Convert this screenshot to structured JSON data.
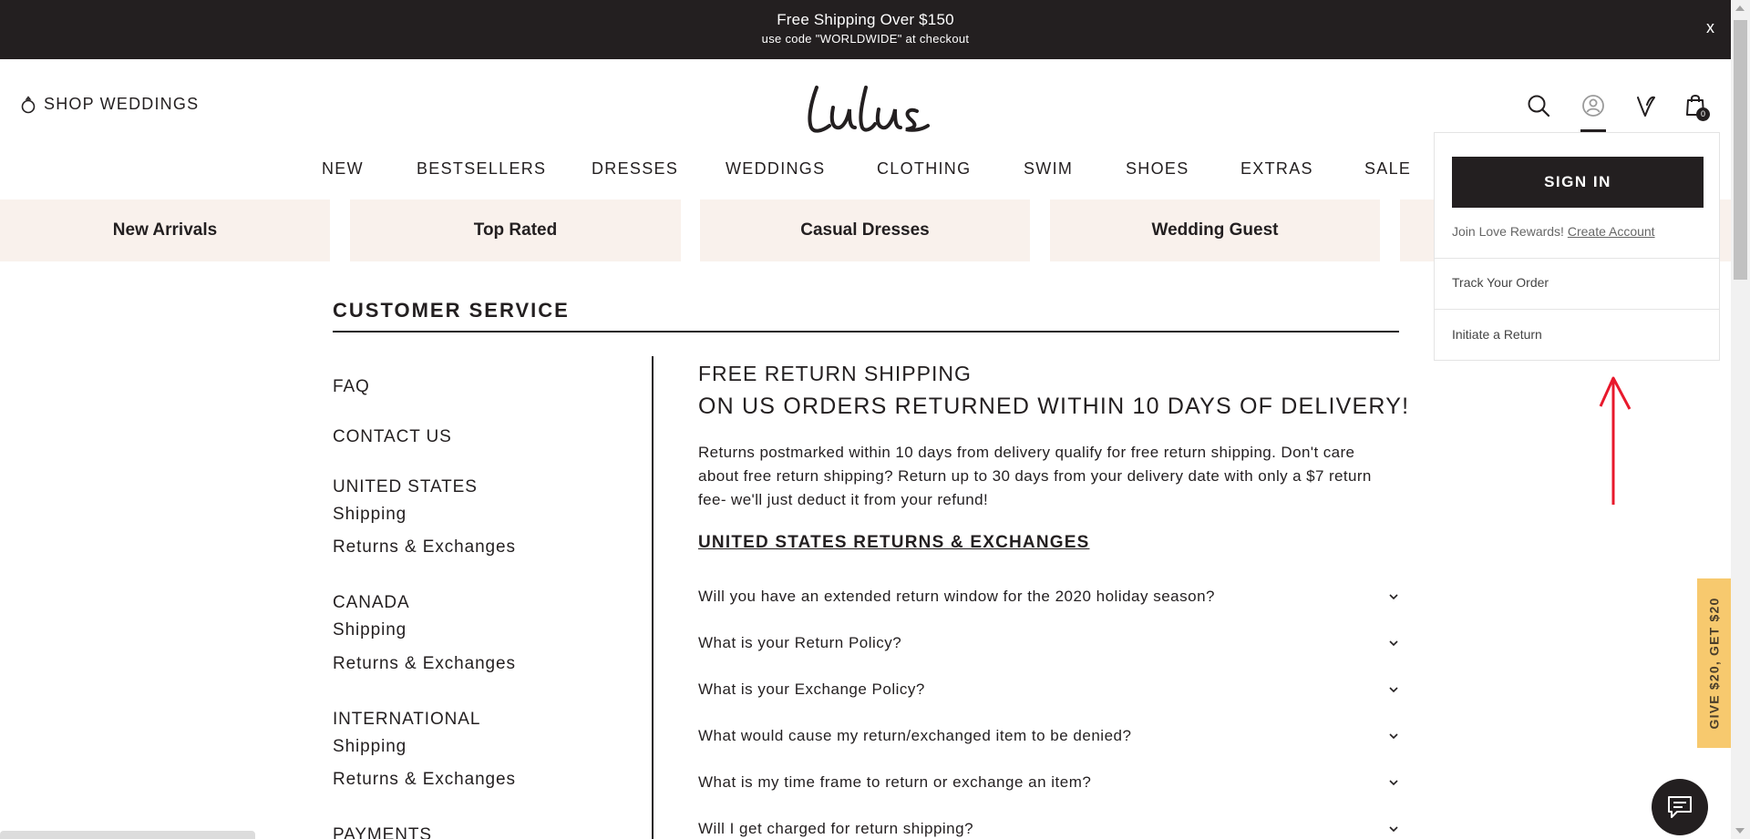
{
  "promo": {
    "line1": "Free Shipping Over $150",
    "line2": "use code \"WORLDWIDE\" at checkout",
    "close": "x"
  },
  "header": {
    "shop_weddings": "SHOP WEDDINGS",
    "logo": "Lulus",
    "cart_count": "0",
    "icons": [
      "search-icon",
      "account-icon",
      "wishlist-icon",
      "cart-icon"
    ]
  },
  "nav": [
    "NEW",
    "BESTSELLERS",
    "DRESSES",
    "WEDDINGS",
    "CLOTHING",
    "SWIM",
    "SHOES",
    "EXTRAS",
    "SALE"
  ],
  "tiles": [
    "New Arrivals",
    "Top Rated",
    "Casual Dresses",
    "Wedding Guest",
    ""
  ],
  "customer_service": {
    "title": "CUSTOMER SERVICE"
  },
  "sidebar": {
    "faq": "FAQ",
    "contact": "CONTACT US",
    "us": {
      "heading": "UNITED STATES",
      "shipping": "Shipping",
      "returns": "Returns & Exchanges"
    },
    "canada": {
      "heading": "CANADA",
      "shipping": "Shipping",
      "returns": "Returns & Exchanges"
    },
    "international": {
      "heading": "INTERNATIONAL",
      "shipping": "Shipping",
      "returns": "Returns & Exchanges"
    },
    "payments": "PAYMENTS"
  },
  "content": {
    "heading1": "FREE RETURN SHIPPING",
    "heading2": "ON US ORDERS RETURNED WITHIN 10 DAYS OF DELIVERY!",
    "paragraph": "Returns postmarked within 10 days from delivery qualify for free return shipping. Don't care about free return shipping? Return up to 30 days from your delivery date with only a $7 return fee- we'll just deduct it from your refund!",
    "section_title": "UNITED STATES RETURNS & EXCHANGES",
    "faqs": [
      "Will you have an extended return window for the 2020 holiday season?",
      "What is your Return Policy?",
      "What is your Exchange Policy?",
      "What would cause my return/exchanged item to be denied?",
      "What is my time frame to return or exchange an item?",
      "Will I get charged for return shipping?"
    ]
  },
  "dropdown": {
    "sign_in": "SIGN IN",
    "rewards_text": "Join Love Rewards!",
    "create_account": "Create Account",
    "track_order": "Track Your Order",
    "initiate_return": "Initiate a Return"
  },
  "side_tab": "GIVE $20, GET $20",
  "colors": {
    "dark": "#231f20",
    "tile_bg": "#f9f1ec",
    "side_tab": "#f7c96e",
    "annotation_arrow": "#e8192c"
  }
}
